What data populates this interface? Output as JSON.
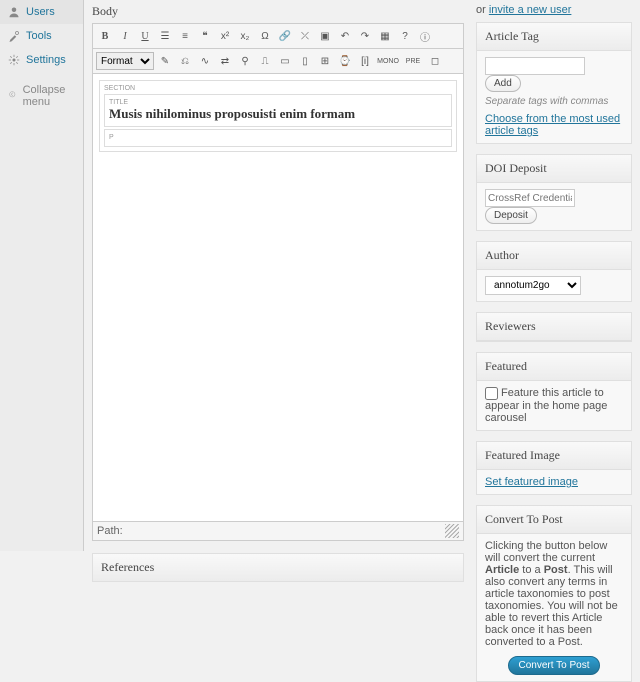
{
  "sidebar": {
    "items": [
      {
        "label": "Users"
      },
      {
        "label": "Tools"
      },
      {
        "label": "Settings"
      }
    ],
    "collapse": "Collapse menu"
  },
  "editor": {
    "body_label": "Body",
    "format": "Format",
    "section_tag": "SECTION",
    "title_tag": "TITLE",
    "title_text": "Musis nihilominus proposuisti enim formam",
    "para_tag": "P",
    "path_label": "Path:",
    "references": "References"
  },
  "top": {
    "or": "or ",
    "invite": "invite a new user"
  },
  "tag": {
    "heading": "Article Tag",
    "add": "Add",
    "hint": "Separate tags with commas",
    "choose": "Choose from the most used article tags"
  },
  "doi": {
    "heading": "DOI Deposit",
    "placeholder": "CrossRef Credentials R",
    "deposit": "Deposit"
  },
  "author": {
    "heading": "Author",
    "value": "annotum2go"
  },
  "reviewers": {
    "heading": "Reviewers"
  },
  "featured": {
    "heading": "Featured",
    "text": "Feature this article to appear in the home page carousel"
  },
  "fimg": {
    "heading": "Featured Image",
    "set": "Set featured image"
  },
  "convert": {
    "heading": "Convert To Post",
    "desc1": "Clicking the button below will convert the current ",
    "article": "Article",
    "to_a": " to a ",
    "post": "Post",
    "desc2": ". This will also convert any terms in article taxonomies to post taxonomies. You will not be able to revert this Article back once it has been converted to a Post.",
    "btn": "Convert To Post"
  }
}
